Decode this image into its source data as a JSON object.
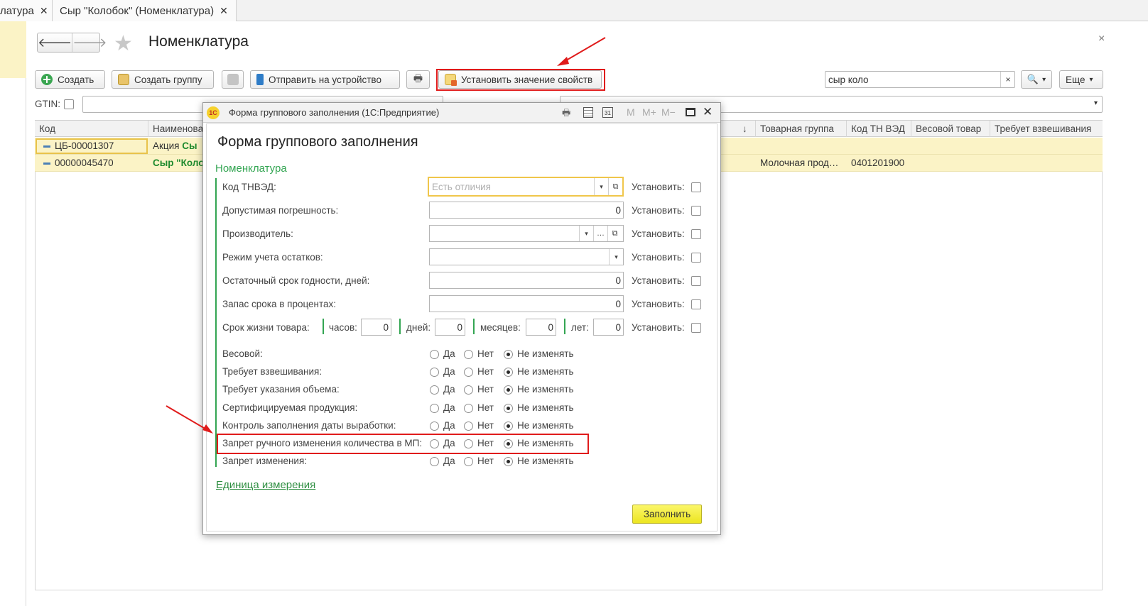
{
  "tabs": [
    {
      "label": "латура"
    },
    {
      "label": "Сыр \"Колобок\" (Номенклатура)"
    }
  ],
  "tab_close": "✕",
  "page": {
    "title": "Номенклатура",
    "close": "×"
  },
  "nav": {
    "back": "🡐",
    "forward": "🡒"
  },
  "toolbar": {
    "create": "Создать",
    "create_group": "Создать группу",
    "send_device": "Отправить на устройство",
    "set_props": "Установить значение свойств",
    "search_value": "сыр коло",
    "search_clear": "×",
    "more": "Еще",
    "dropdown": "▾"
  },
  "filter": {
    "gtin_label": "GTIN:"
  },
  "grid": {
    "columns": [
      "Код",
      "Наименова",
      "↓",
      "Товарная группа",
      "Код ТН ВЭД",
      "Весовой товар",
      "Требует взвешивания"
    ],
    "rows": [
      {
        "code": "ЦБ-00001307",
        "name": "Акция",
        "name_bold": "Сы",
        "group": "",
        "tnved": ""
      },
      {
        "code": "00000045470",
        "name": "",
        "name_bold": "Сыр \"Коло",
        "group": "Молочная прод…",
        "tnved": "0401201900"
      }
    ]
  },
  "dialog": {
    "window_title": "Форма группового заполнения  (1С:Предприятие)",
    "logo": "1С",
    "title_icons": [
      "M",
      "M+",
      "M−"
    ],
    "heading": "Форма группового заполнения",
    "section": "Номенклатура",
    "set_label": "Установить:",
    "placeholder": "Есть отличия",
    "fields": [
      {
        "label": "Код ТНВЭД:",
        "value": ""
      },
      {
        "label": "Допустимая погрешность:",
        "value": "0"
      },
      {
        "label": "Производитель:",
        "value": ""
      },
      {
        "label": "Режим учета остатков:",
        "value": ""
      },
      {
        "label": "Остаточный срок годности, дней:",
        "value": "0"
      },
      {
        "label": "Запас срока в процентах:",
        "value": "0"
      }
    ],
    "lifetime": {
      "label": "Срок жизни товара:",
      "hours_label": "часов:",
      "hours": "0",
      "days_label": "дней:",
      "days": "0",
      "months_label": "месяцев:",
      "months": "0",
      "years_label": "лет:",
      "years": "0"
    },
    "radio_options": [
      "Да",
      "Нет",
      "Не изменять"
    ],
    "radio_rows": [
      "Весовой:",
      "Требует взвешивания:",
      "Требует указания объема:",
      "Сертифицируемая продукция:",
      "Контроль заполнения даты выработки:",
      "Запрет ручного изменения количества в МП:",
      "Запрет изменения:"
    ],
    "unit_link": "Единица измерения",
    "fill_button": "Заполнить"
  },
  "colors": {
    "accent_green": "#33a552",
    "highlight": "#e01b1b",
    "row_yellow": "#fbf3c6",
    "fill_button": "#f4ef3c"
  }
}
